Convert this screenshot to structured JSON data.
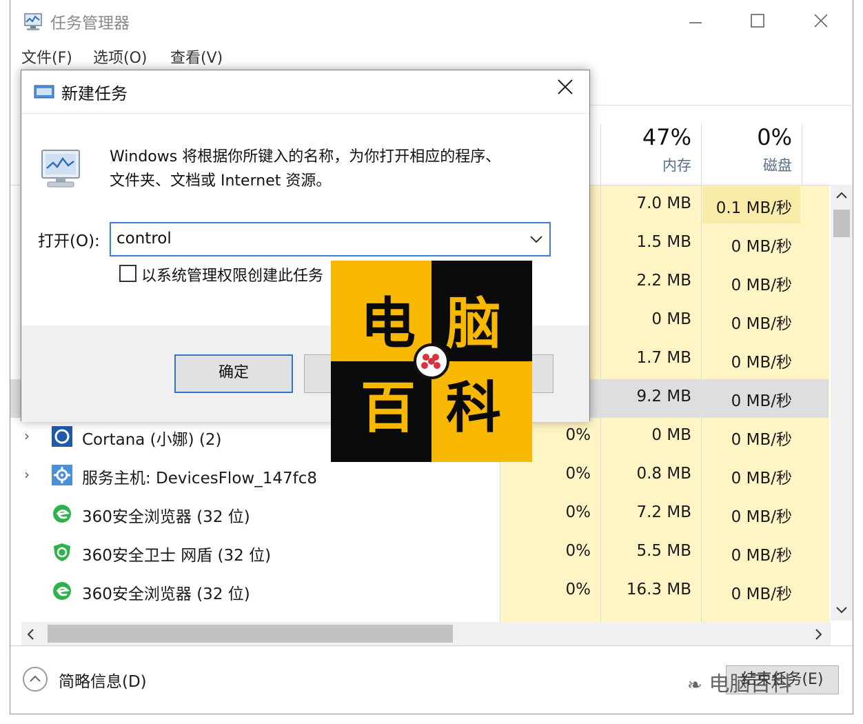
{
  "task_manager": {
    "title": "任务管理器",
    "menu": [
      "文件(F)",
      "选项(O)",
      "查看(V)"
    ],
    "columns": [
      {
        "percent": "47%",
        "label": "内存"
      },
      {
        "percent": "0%",
        "label": "磁盘"
      }
    ],
    "rows": [
      {
        "name": "",
        "cpu": "",
        "memory": "7.0 MB",
        "disk": "0.1 MB/秒"
      },
      {
        "name": "",
        "cpu": "",
        "memory": "1.5 MB",
        "disk": "0 MB/秒"
      },
      {
        "name": "",
        "cpu": "",
        "memory": "2.2 MB",
        "disk": "0 MB/秒"
      },
      {
        "name": "",
        "cpu": "",
        "memory": "0 MB",
        "disk": "0 MB/秒"
      },
      {
        "name": "",
        "cpu": "",
        "memory": "1.7 MB",
        "disk": "0 MB/秒"
      },
      {
        "name": "",
        "cpu": "",
        "memory": "9.2 MB",
        "disk": "0 MB/秒",
        "selected": true
      },
      {
        "name": "Cortana (小娜) (2)",
        "cpu": "0%",
        "memory": "0 MB",
        "disk": "0 MB/秒",
        "icon": "cortana-icon",
        "expandable": true
      },
      {
        "name": "服务主机: DevicesFlow_147fc8",
        "cpu": "0%",
        "memory": "0.8 MB",
        "disk": "0 MB/秒",
        "icon": "gear-icon",
        "expandable": true
      },
      {
        "name": "360安全浏览器 (32 位)",
        "cpu": "0%",
        "memory": "7.2 MB",
        "disk": "0 MB/秒",
        "icon": "360-browser-icon"
      },
      {
        "name": "360安全卫士 网盾 (32 位)",
        "cpu": "0%",
        "memory": "5.5 MB",
        "disk": "0 MB/秒",
        "icon": "360-shield-icon"
      },
      {
        "name": "360安全浏览器 (32 位)",
        "cpu": "0%",
        "memory": "16.3 MB",
        "disk": "0 MB/秒",
        "icon": "360-browser-icon"
      }
    ],
    "footer": {
      "fewer_details": "简略信息(D)",
      "end_task": "结束任务(E)"
    }
  },
  "run_dialog": {
    "title": "新建任务",
    "description_line1": "Windows 将根据你所键入的名称，为你打开相应的程序、",
    "description_line2": "文件夹、文档或 Internet 资源。",
    "open_label": "打开(O):",
    "open_value": "control",
    "admin_checkbox_label": "以系统管理权限创建此任务",
    "ok_label": "确定"
  },
  "overlay_logo": {
    "chars": [
      "电",
      "脑",
      "百",
      "科"
    ],
    "colors": {
      "yellow": "#f8b800",
      "black": "#0b0b0b"
    }
  },
  "watermark_text": "电脑百科",
  "colors": {
    "heat_light": "#fff4c4",
    "heat_mid": "#f9eca8",
    "accent_blue": "#2f74c9"
  }
}
